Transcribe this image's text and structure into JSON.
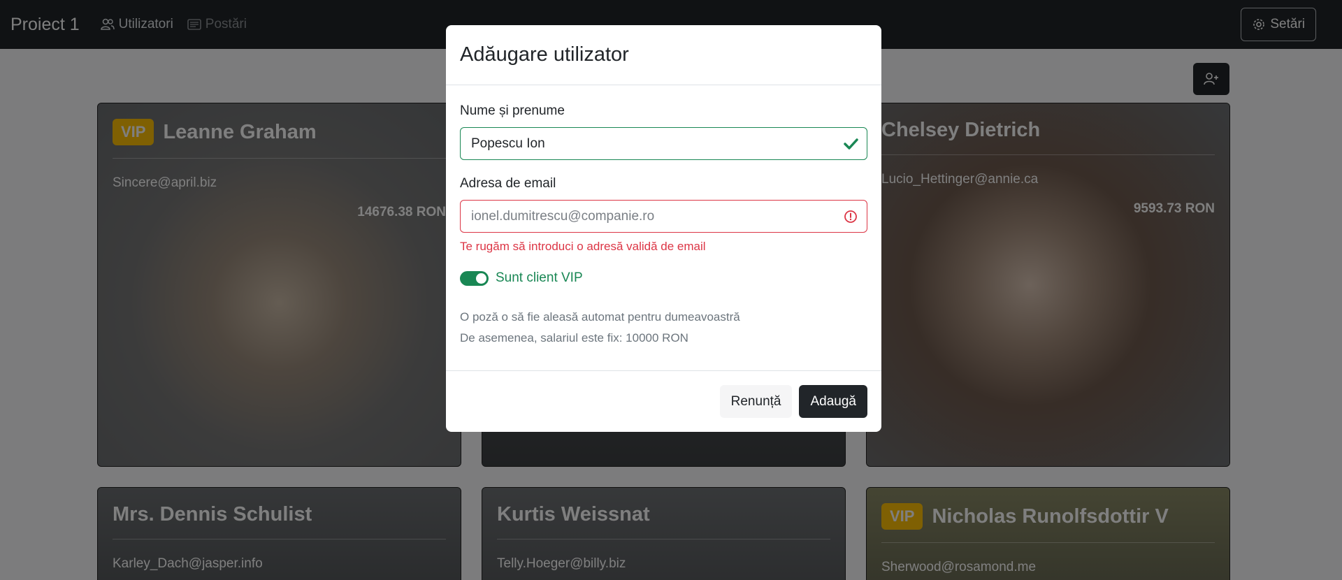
{
  "navbar": {
    "brand": "Proiect 1",
    "links": [
      {
        "label": "Utilizatori",
        "icon": "users-icon"
      },
      {
        "label": "Postări",
        "icon": "posts-icon"
      }
    ],
    "settings_label": "Setări"
  },
  "cards": [
    {
      "name": "Leanne Graham",
      "vip": true,
      "vip_label": "VIP",
      "email": "Sincere@april.biz",
      "salary": "14676.38 RON"
    },
    {
      "name": "",
      "vip": false,
      "email": "",
      "salary": ""
    },
    {
      "name": "Chelsey Dietrich",
      "vip": false,
      "email": "Lucio_Hettinger@annie.ca",
      "salary": "9593.73 RON"
    },
    {
      "name": "Mrs. Dennis Schulist",
      "vip": false,
      "email": "Karley_Dach@jasper.info",
      "salary": ""
    },
    {
      "name": "Kurtis Weissnat",
      "vip": false,
      "email": "Telly.Hoeger@billy.biz",
      "salary": ""
    },
    {
      "name": "Nicholas Runolfsdottir V",
      "vip": true,
      "vip_label": "VIP",
      "email": "Sherwood@rosamond.me",
      "salary": ""
    }
  ],
  "modal": {
    "title": "Adăugare utilizator",
    "name_label": "Nume și prenume",
    "name_value": "Popescu Ion",
    "email_label": "Adresa de email",
    "email_value": "ionel.dumitrescu@companie.ro",
    "email_error": "Te rugăm să introduci o adresă validă de email",
    "vip_switch_label": "Sunt client VIP",
    "vip_switch_on": true,
    "note_line1": "O poză o să fie aleasă automat pentru dumeavoastră",
    "note_line2": "De asemenea, salariul este fix: 10000 RON",
    "cancel_label": "Renunță",
    "add_label": "Adaugă"
  },
  "colors": {
    "navbar_bg": "#212529",
    "vip_badge": "#ffc107",
    "valid": "#198754",
    "invalid": "#dc3545"
  }
}
